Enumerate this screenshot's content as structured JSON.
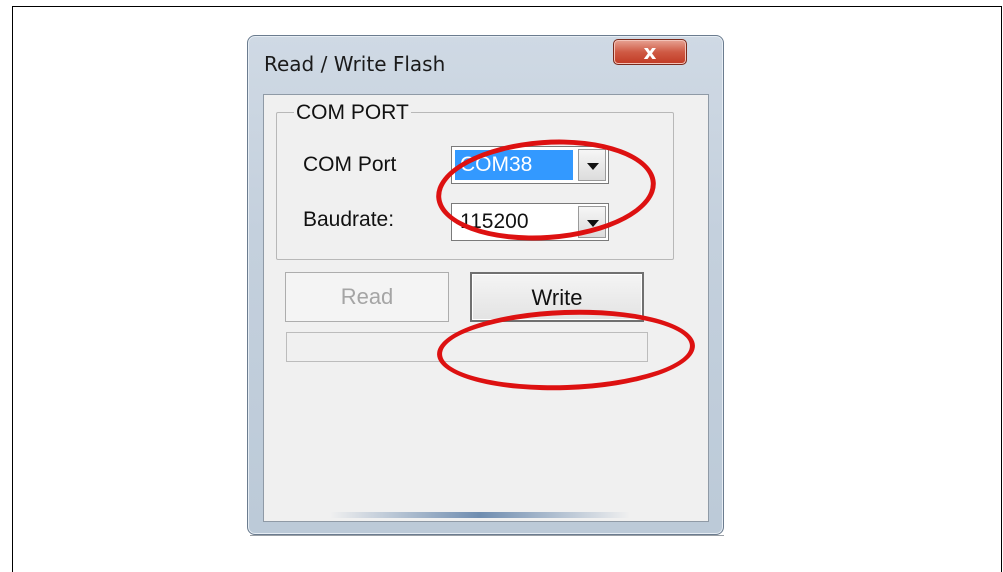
{
  "window": {
    "title": "Read / Write Flash",
    "close_glyph": "x"
  },
  "com_port_group": {
    "label": "COM PORT",
    "com_port_label": "COM Port",
    "com_port_value": "COM38",
    "baudrate_label": "Baudrate:",
    "baudrate_value": "115200"
  },
  "buttons": {
    "read_label": "Read",
    "write_label": "Write"
  },
  "progress": {
    "fraction": 0
  },
  "annotations": {
    "highlight_color": "#dd1111",
    "highlighted": [
      "com-port-select",
      "write-button"
    ]
  },
  "colors": {
    "selection": "#3399ff",
    "close_button": "#c13a24"
  }
}
